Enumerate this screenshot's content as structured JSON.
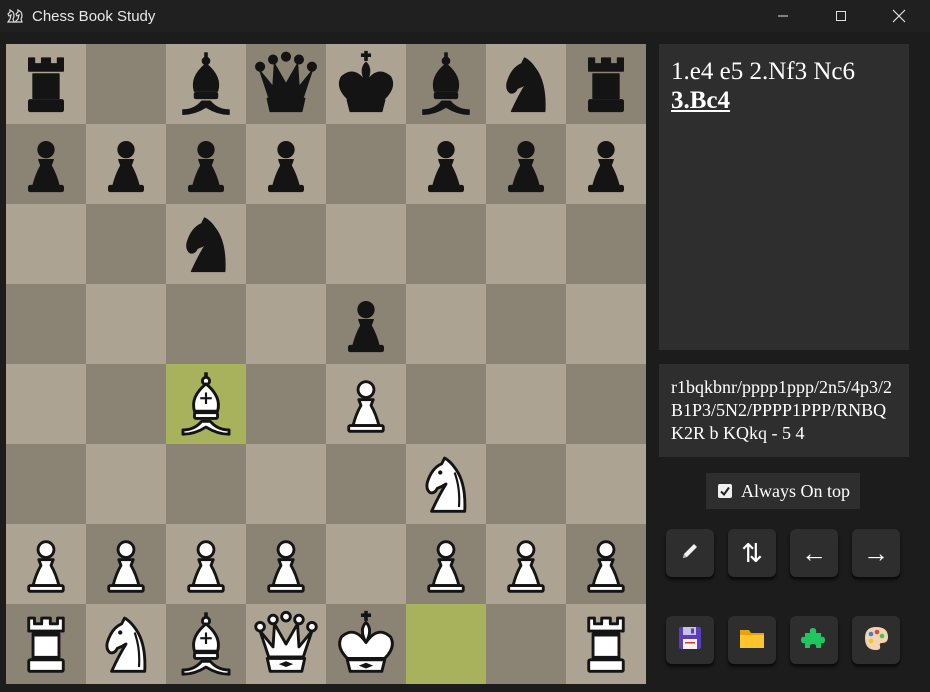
{
  "window": {
    "title": "Chess Book Study",
    "app_icon": "chess-knights-icon",
    "controls": [
      "minimize-icon",
      "maximize-icon",
      "close-icon"
    ]
  },
  "board": {
    "orientation": "white-bottom",
    "light_color": "#aca393",
    "dark_color": "#8b8374",
    "highlight_color": "#a8b15b",
    "highlight_squares": [
      "c4",
      "f1"
    ],
    "ranks": [
      [
        "r",
        "",
        "b",
        "q",
        "k",
        "b",
        "n",
        "r"
      ],
      [
        "p",
        "p",
        "p",
        "p",
        "",
        "p",
        "p",
        "p"
      ],
      [
        "",
        "",
        "n",
        "",
        "",
        "",
        "",
        ""
      ],
      [
        "",
        "",
        "",
        "",
        "p",
        "",
        "",
        ""
      ],
      [
        "",
        "",
        "B",
        "",
        "P",
        "",
        "",
        ""
      ],
      [
        "",
        "",
        "",
        "",
        "",
        "N",
        "",
        ""
      ],
      [
        "P",
        "P",
        "P",
        "P",
        "",
        "P",
        "P",
        "P"
      ],
      [
        "R",
        "N",
        "B",
        "Q",
        "K",
        "",
        "",
        "R"
      ]
    ]
  },
  "moves": {
    "line1": "1.e4 e5 2.Nf3 Nc6",
    "current_move": "3.Bc4"
  },
  "fen": "r1bqkbnr/pppp1ppp/2n5/4p3/2B1P3/5N2/PPPP1PPP/RNBQK2R b KQkq - 5 4",
  "always_on_top": {
    "label": "Always On top",
    "checked": true
  },
  "toolbar_row1": [
    {
      "name": "edit-button",
      "icon": "pencil-icon"
    },
    {
      "name": "flip-board-button",
      "icon": "swap-vertical-icon",
      "label": "⇅"
    },
    {
      "name": "previous-move-button",
      "icon": "arrow-left-icon",
      "label": "←"
    },
    {
      "name": "next-move-button",
      "icon": "arrow-right-icon",
      "label": "→"
    }
  ],
  "toolbar_row2": [
    {
      "name": "save-button",
      "icon": "floppy-disk-icon"
    },
    {
      "name": "open-button",
      "icon": "folder-icon"
    },
    {
      "name": "puzzle-button",
      "icon": "puzzle-icon"
    },
    {
      "name": "theme-button",
      "icon": "palette-icon"
    }
  ]
}
